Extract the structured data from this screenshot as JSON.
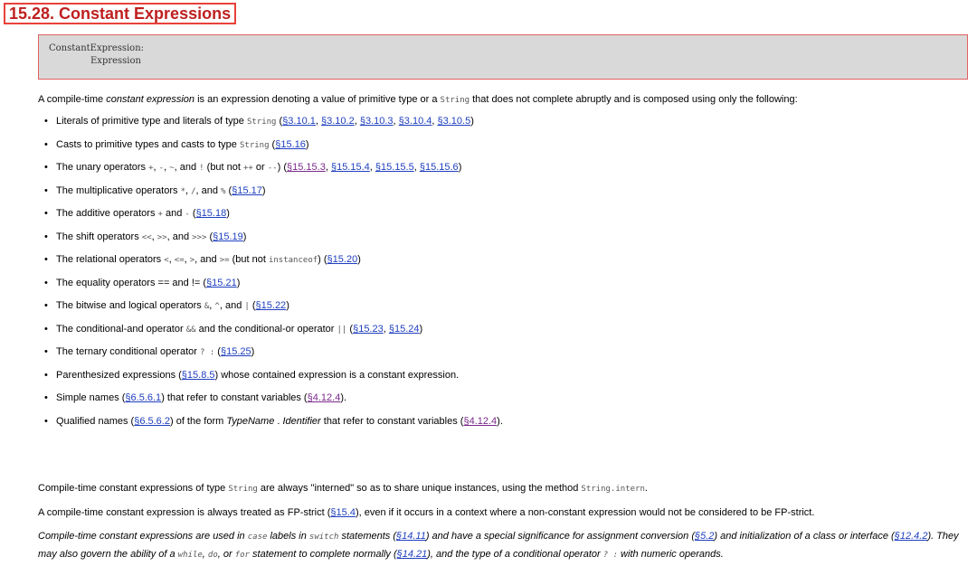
{
  "title": "15.28. Constant Expressions",
  "grammar": {
    "lhs": "ConstantExpression:",
    "rhs": "Expression"
  },
  "intro": {
    "a": "A compile-time ",
    "em": "constant expression",
    "b": " is an expression denoting a value of primitive type or a ",
    "code": "String",
    "c": " that does not complete abruptly and is composed using only the following:"
  },
  "items": [
    {
      "t1": "Literals of primitive type and literals of type ",
      "c1": "String",
      "t2": " (",
      "links": [
        "§3.10.1",
        "§3.10.2",
        "§3.10.3",
        "§3.10.4",
        "§3.10.5"
      ],
      "t3": ")"
    },
    {
      "t1": "Casts to primitive types and casts to type ",
      "c1": "String",
      "t2": " (",
      "links": [
        "§15.16"
      ],
      "t3": ")"
    },
    {
      "t1": "The unary operators ",
      "c1": "+",
      "t2": ", ",
      "c2": "-",
      "t3": ", ",
      "c3": "~",
      "t4": ", and ",
      "c4": "!",
      "t5": " (but not ",
      "c5": "++",
      "t6": " or ",
      "c6": "--",
      "t7": ") (",
      "links": [
        "§15.15.3",
        "§15.15.4",
        "§15.15.5",
        "§15.15.6"
      ],
      "t8": ")"
    },
    {
      "t1": "The multiplicative operators ",
      "c1": "*",
      "t2": ", ",
      "c2": "/",
      "t3": ", and ",
      "c3": "%",
      "t4": " (",
      "links": [
        "§15.17"
      ],
      "t5": ")"
    },
    {
      "t1": "The additive operators ",
      "c1": "+",
      "t2": " and ",
      "c2": "-",
      "t3": " (",
      "links": [
        "§15.18"
      ],
      "t4": ")"
    },
    {
      "t1": "The shift operators ",
      "c1": "<<",
      "t2": ", ",
      "c2": ">>",
      "t3": ", and ",
      "c3": ">>>",
      "t4": " (",
      "links": [
        "§15.19"
      ],
      "t5": ")"
    },
    {
      "t1": "The relational operators ",
      "c1": "<",
      "t2": ", ",
      "c2": "<=",
      "t3": ", ",
      "c3": ">",
      "t4": ", and ",
      "c4": ">=",
      "t5": " (but not ",
      "c5": "instanceof",
      "t6": ") (",
      "links": [
        "§15.20"
      ],
      "t7": ")"
    },
    {
      "t1": "The equality operators ",
      "c1": "==",
      "t2": " and ",
      "c2": "!=",
      "t3": " (",
      "links": [
        "§15.21"
      ],
      "t4": ")"
    },
    {
      "t1": "The bitwise and logical operators ",
      "c1": "&",
      "t2": ", ",
      "c2": "^",
      "t3": ", and ",
      "c3": "|",
      "t4": " (",
      "links": [
        "§15.22"
      ],
      "t5": ")"
    },
    {
      "t1": "The conditional-and operator ",
      "c1": "&&",
      "t2": " and the conditional-or operator ",
      "c2": "||",
      "t3": " (",
      "links": [
        "§15.23",
        "§15.24"
      ],
      "t4": ")"
    },
    {
      "t1": "The ternary conditional operator ",
      "c1": "? :",
      "t2": " (",
      "links": [
        "§15.25"
      ],
      "t3": ")"
    },
    {
      "t1": "Parenthesized expressions (",
      "links": [
        "§15.8.5"
      ],
      "t2": ") whose contained expression is a constant expression."
    },
    {
      "t1": "Simple names (",
      "link1": "§6.5.6.1",
      "t2": ") that refer to constant variables (",
      "link2": "§4.12.4",
      "t3": ")."
    },
    {
      "t1": "Qualified names (",
      "link1": "§6.5.6.2",
      "t2": ") of the form ",
      "e1": "TypeName",
      "t3": " . ",
      "e2": "Identifier",
      "t4": " that refer to constant variables (",
      "link2": "§4.12.4",
      "t5": ")."
    }
  ],
  "para1": {
    "a": "Compile-time constant expressions of type ",
    "c1": "String",
    "b": " are always \"interned\" so as to share unique instances, using the method ",
    "c2": "String.intern",
    "d": "."
  },
  "para2": {
    "a": "A compile-time constant expression is always treated as FP-strict (",
    "link": "§15.4",
    "b": "), even if it occurs in a context where a non-constant expression would not be considered to be FP-strict."
  },
  "note": {
    "a": "Compile-time constant expressions are used in ",
    "c1": "case",
    "b": " labels in ",
    "c2": "switch",
    "c": " statements (",
    "l1": "§14.11",
    "d": ") and have a special significance for assignment conversion (",
    "l2": "§5.2",
    "e": ") and initialization of a class or interface (",
    "l3": "§12.4.2",
    "f": "). They may also govern the ability of a ",
    "c3": "while",
    "g": ", ",
    "c4": "do",
    "h": ", or ",
    "c5": "for",
    "i": " statement to complete normally (",
    "l4": "§14.21",
    "j": "), and the type of a conditional operator ",
    "c6": "? :",
    "k": " with numeric operands."
  }
}
